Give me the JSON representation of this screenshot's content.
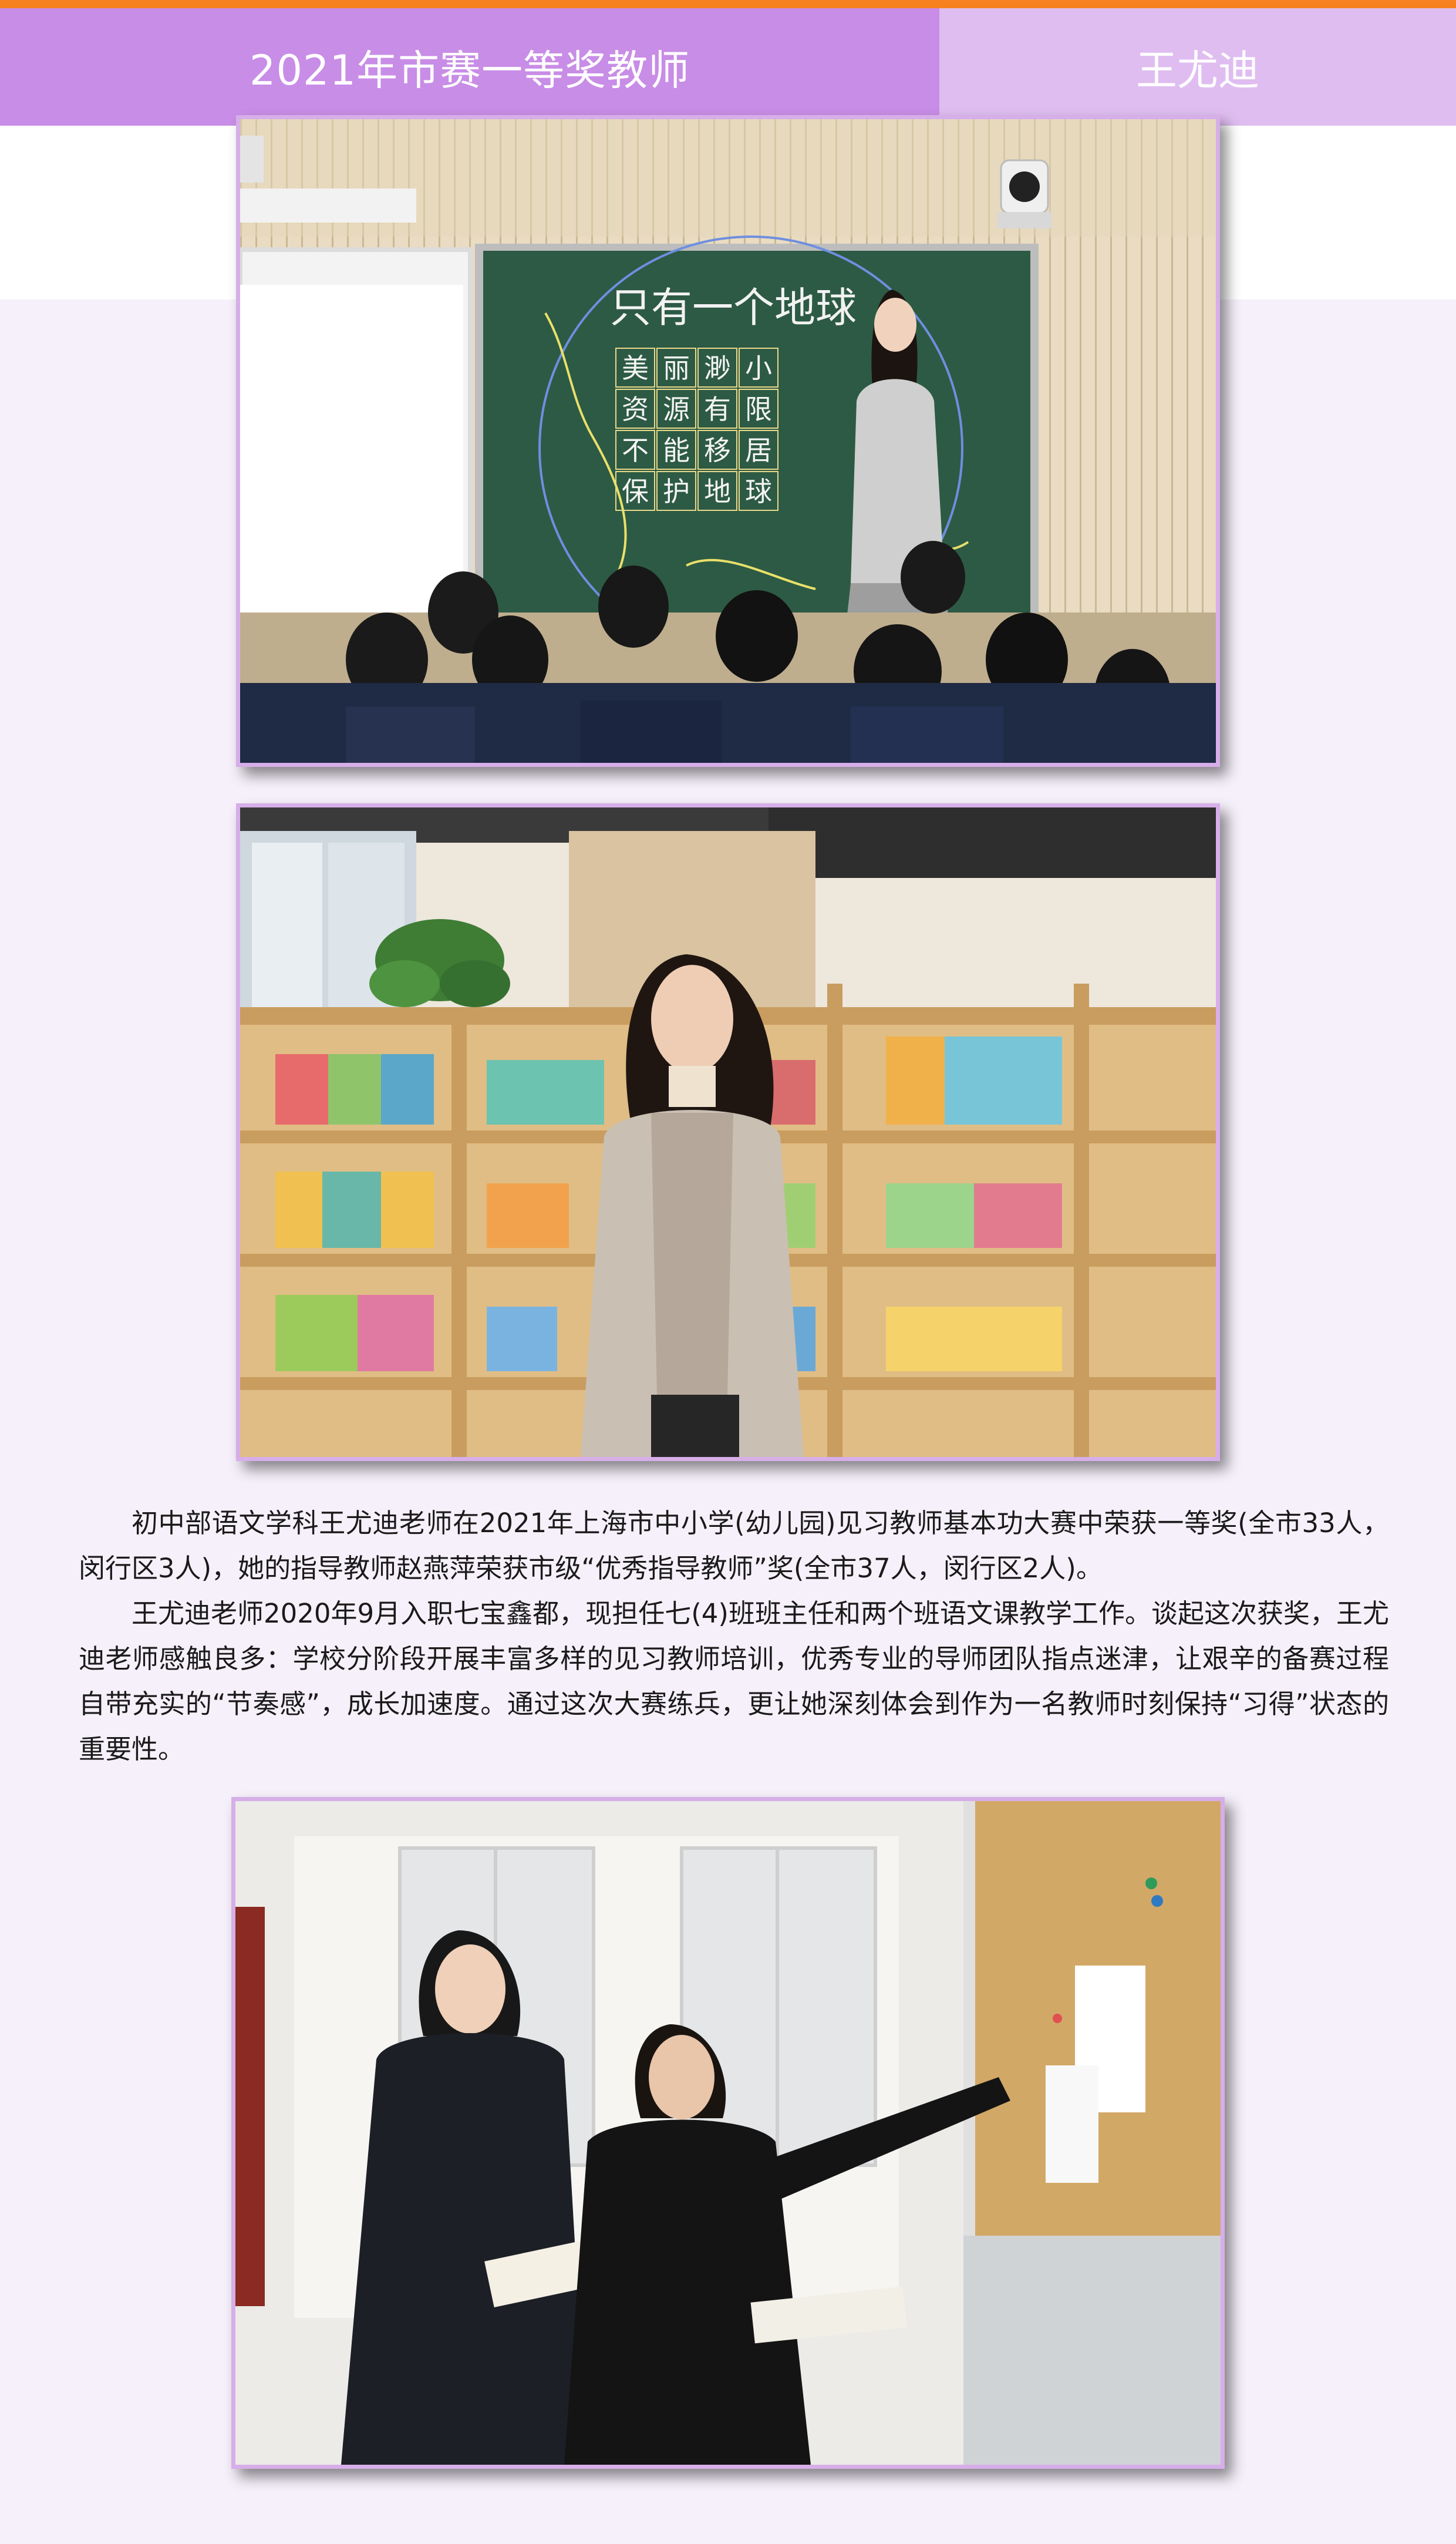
{
  "header": {
    "title": "2021年市赛一等奖教师",
    "name": "王尤迪"
  },
  "photos": {
    "classroom": {
      "board_title": "只有一个地球",
      "board_grid": [
        [
          "美",
          "丽",
          "渺",
          "小"
        ],
        [
          "资",
          "源",
          "有",
          "限"
        ],
        [
          "不",
          "能",
          "移",
          "居"
        ],
        [
          "保",
          "护",
          "地",
          "球"
        ]
      ]
    },
    "library": {},
    "office": {}
  },
  "article": {
    "paragraphs": [
      "初中部语文学科王尤迪老师在2021年上海市中小学(幼儿园)见习教师基本功大赛中荣获一等奖(全市33人，闵行区3人)，她的指导教师赵燕萍荣获市级“优秀指导教师”奖(全市37人，闵行区2人)。",
      "王尤迪老师2020年9月入职七宝鑫都，现担任七(4)班班主任和两个班语文课教学工作。谈起这次获奖，王尤迪老师感触良多：学校分阶段开展丰富多样的见习教师培训，优秀专业的导师团队指点迷津，让艰辛的备赛过程自带充实的“节奏感”，成长加速度。通过这次大赛练兵，更让她深刻体会到作为一名教师时刻保持“习得”状态的重要性。"
    ]
  },
  "colors": {
    "accent_orange": "#f5821f",
    "header_purple": "#c88de6",
    "header_light_purple": "#dfbdf0",
    "page_background": "#f6f0fa"
  }
}
